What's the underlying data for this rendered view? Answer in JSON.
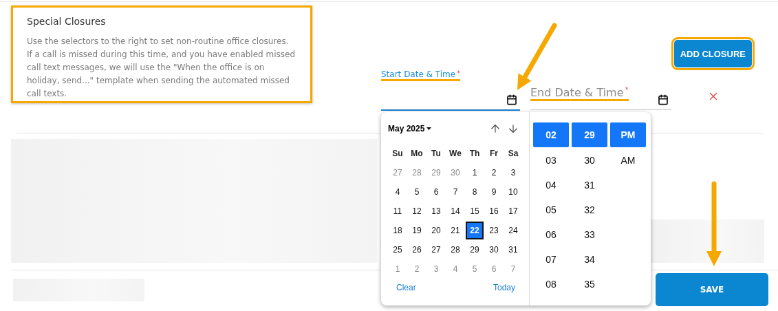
{
  "section": {
    "title": "Special Closures",
    "description": "Use the selectors to the right to set non-routine office closures. If a call is missed during this time, and you have enabled missed call text messages, we will use the \"When the office is on holiday, send...\" template when sending the automated missed call texts."
  },
  "add_button": "ADD CLOSURE",
  "start_field": {
    "label": "Start Date & Time",
    "required_mark": "*",
    "focused": true
  },
  "end_field": {
    "label": "End Date & Time",
    "required_mark": "*",
    "focused": false
  },
  "picker": {
    "month": "May 2025",
    "weekdays": [
      "Su",
      "Mo",
      "Tu",
      "We",
      "Th",
      "Fr",
      "Sa"
    ],
    "days": [
      {
        "label": "27",
        "muted": true,
        "selected": false
      },
      {
        "label": "28",
        "muted": true,
        "selected": false
      },
      {
        "label": "29",
        "muted": true,
        "selected": false
      },
      {
        "label": "30",
        "muted": true,
        "selected": false
      },
      {
        "label": "1",
        "muted": false,
        "selected": false
      },
      {
        "label": "2",
        "muted": false,
        "selected": false
      },
      {
        "label": "3",
        "muted": false,
        "selected": false
      },
      {
        "label": "4",
        "muted": false,
        "selected": false
      },
      {
        "label": "5",
        "muted": false,
        "selected": false
      },
      {
        "label": "6",
        "muted": false,
        "selected": false
      },
      {
        "label": "7",
        "muted": false,
        "selected": false
      },
      {
        "label": "8",
        "muted": false,
        "selected": false
      },
      {
        "label": "9",
        "muted": false,
        "selected": false
      },
      {
        "label": "10",
        "muted": false,
        "selected": false
      },
      {
        "label": "11",
        "muted": false,
        "selected": false
      },
      {
        "label": "12",
        "muted": false,
        "selected": false
      },
      {
        "label": "13",
        "muted": false,
        "selected": false
      },
      {
        "label": "14",
        "muted": false,
        "selected": false
      },
      {
        "label": "15",
        "muted": false,
        "selected": false
      },
      {
        "label": "16",
        "muted": false,
        "selected": false
      },
      {
        "label": "17",
        "muted": false,
        "selected": false
      },
      {
        "label": "18",
        "muted": false,
        "selected": false
      },
      {
        "label": "19",
        "muted": false,
        "selected": false
      },
      {
        "label": "20",
        "muted": false,
        "selected": false
      },
      {
        "label": "21",
        "muted": false,
        "selected": false
      },
      {
        "label": "22",
        "muted": false,
        "selected": true
      },
      {
        "label": "23",
        "muted": false,
        "selected": false
      },
      {
        "label": "24",
        "muted": false,
        "selected": false
      },
      {
        "label": "25",
        "muted": false,
        "selected": false
      },
      {
        "label": "26",
        "muted": false,
        "selected": false
      },
      {
        "label": "27",
        "muted": false,
        "selected": false
      },
      {
        "label": "28",
        "muted": false,
        "selected": false
      },
      {
        "label": "29",
        "muted": false,
        "selected": false
      },
      {
        "label": "30",
        "muted": false,
        "selected": false
      },
      {
        "label": "31",
        "muted": false,
        "selected": false
      },
      {
        "label": "1",
        "muted": true,
        "selected": false
      },
      {
        "label": "2",
        "muted": true,
        "selected": false
      },
      {
        "label": "3",
        "muted": true,
        "selected": false
      },
      {
        "label": "4",
        "muted": true,
        "selected": false
      },
      {
        "label": "5",
        "muted": true,
        "selected": false
      },
      {
        "label": "6",
        "muted": true,
        "selected": false
      },
      {
        "label": "7",
        "muted": true,
        "selected": false
      }
    ],
    "clear": "Clear",
    "today": "Today",
    "time_columns": [
      [
        {
          "label": "02",
          "selected": true
        },
        {
          "label": "03",
          "selected": false
        },
        {
          "label": "04",
          "selected": false
        },
        {
          "label": "05",
          "selected": false
        },
        {
          "label": "06",
          "selected": false
        },
        {
          "label": "07",
          "selected": false
        },
        {
          "label": "08",
          "selected": false
        }
      ],
      [
        {
          "label": "29",
          "selected": true
        },
        {
          "label": "30",
          "selected": false
        },
        {
          "label": "31",
          "selected": false
        },
        {
          "label": "32",
          "selected": false
        },
        {
          "label": "33",
          "selected": false
        },
        {
          "label": "34",
          "selected": false
        },
        {
          "label": "35",
          "selected": false
        }
      ],
      [
        {
          "label": "PM",
          "selected": true
        },
        {
          "label": "AM",
          "selected": false
        }
      ]
    ]
  },
  "save_button": "SAVE"
}
